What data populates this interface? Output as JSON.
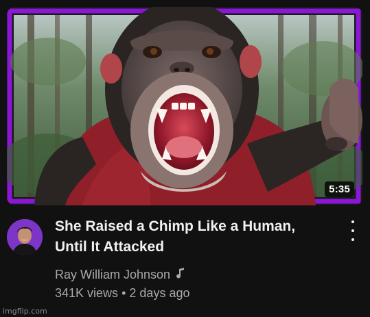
{
  "video": {
    "duration": "5:35",
    "title_line1": "She Raised a Chimp Like a Human,",
    "title_line2": "Until It Attacked",
    "channel": "Ray William Johnson",
    "views": "341K views",
    "separator": "•",
    "age": "2 days ago"
  },
  "icons": {
    "music_note": "music-note-icon",
    "more": "more-vert-icon"
  },
  "colors": {
    "thumbnail_border": "#8a17d6",
    "avatar_bg": "#7d35c8",
    "shirt": "#8f1f28"
  },
  "watermark": "imgflip.com"
}
